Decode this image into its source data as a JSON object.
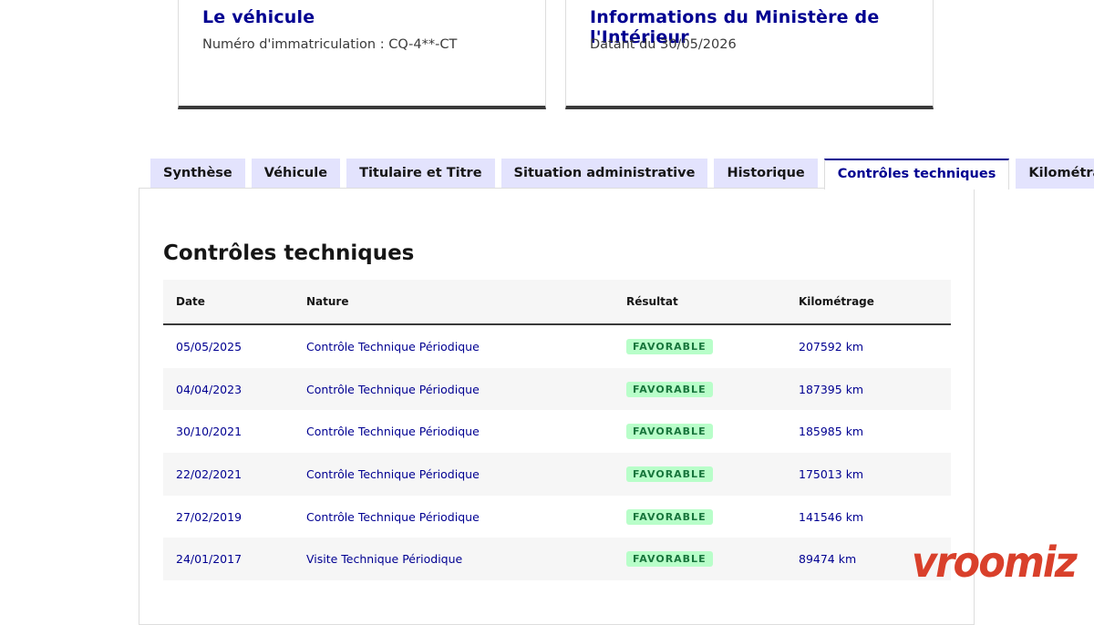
{
  "vehicle_card": {
    "title": "Le véhicule",
    "registration": "Numéro d'immatriculation : CQ-4**-CT"
  },
  "ministry_card": {
    "title": "Informations du Ministère de l'Intérieur",
    "date": "Datant du 30/05/2026"
  },
  "tabs": [
    {
      "label": "Synthèse"
    },
    {
      "label": "Véhicule"
    },
    {
      "label": "Titulaire et Titre"
    },
    {
      "label": "Situation administrative"
    },
    {
      "label": "Historique"
    },
    {
      "label": "Contrôles techniques",
      "active": true
    },
    {
      "label": "Kilométrage"
    }
  ],
  "section": {
    "title": "Contrôles techniques"
  },
  "table": {
    "headers": [
      "Date",
      "Nature",
      "Résultat",
      "Kilométrage"
    ],
    "rows": [
      {
        "date": "05/05/2025",
        "nature": "Contrôle Technique Périodique",
        "result": "FAVORABLE",
        "mileage": "207592 km"
      },
      {
        "date": "04/04/2023",
        "nature": "Contrôle Technique Périodique",
        "result": "FAVORABLE",
        "mileage": "187395 km"
      },
      {
        "date": "30/10/2021",
        "nature": "Contrôle Technique Périodique",
        "result": "FAVORABLE",
        "mileage": "185985 km"
      },
      {
        "date": "22/02/2021",
        "nature": "Contrôle Technique Périodique",
        "result": "FAVORABLE",
        "mileage": "175013 km"
      },
      {
        "date": "27/02/2019",
        "nature": "Contrôle Technique Périodique",
        "result": "FAVORABLE",
        "mileage": "141546 km"
      },
      {
        "date": "24/01/2017",
        "nature": "Visite Technique Périodique",
        "result": "FAVORABLE",
        "mileage": "89474 km"
      }
    ]
  },
  "watermark": {
    "text": "vroomiz",
    "color": "#d9402b"
  },
  "colors": {
    "primary": "#000091",
    "tab_bg": "#e3e3fd",
    "success_bg": "#b8fec9",
    "success_text": "#18753c"
  }
}
